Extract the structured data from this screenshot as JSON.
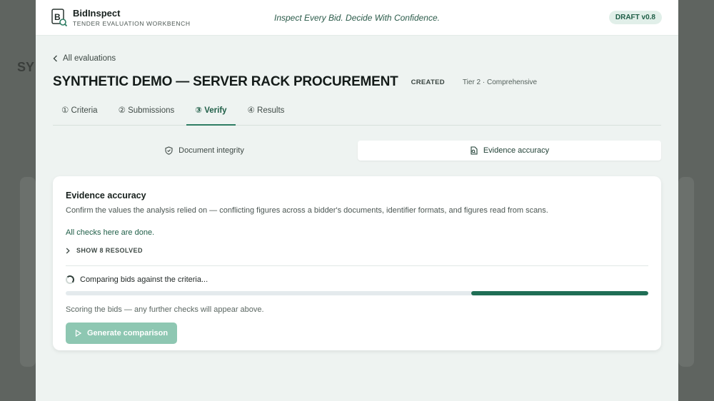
{
  "app": {
    "name": "BidInspect",
    "subtitle": "TENDER EVALUATION WORKBENCH",
    "tagline": "Inspect Every Bid. Decide With Confidence.",
    "version_badge": "DRAFT v0.8",
    "logo_letter": "B"
  },
  "nav": {
    "back_label": "All evaluations"
  },
  "evaluation": {
    "title": "SYNTHETIC DEMO — SERVER RACK PROCUREMENT",
    "status": "CREATED",
    "tier": "Tier 2 · Comprehensive"
  },
  "tabs": [
    {
      "label": "① Criteria",
      "active": false
    },
    {
      "label": "② Submissions",
      "active": false
    },
    {
      "label": "③ Verify",
      "active": true
    },
    {
      "label": "④ Results",
      "active": false
    }
  ],
  "subtabs": [
    {
      "label": "Document integrity",
      "icon": "shield-icon",
      "active": false
    },
    {
      "label": "Evidence accuracy",
      "icon": "document-search-icon",
      "active": true
    }
  ],
  "card": {
    "title": "Evidence accuracy",
    "description": "Confirm the values the analysis relied on — conflicting figures across a bidder's documents, identifier formats, and figures read from scans.",
    "done_message": "All checks here are done.",
    "resolved_toggle": "SHOW 8 RESOLVED",
    "progress_label": "Comparing bids against the criteria...",
    "progress": {
      "start_fraction": 0.696,
      "end_fraction": 1.0
    },
    "scoring_note": "Scoring the bids — any further checks will appear above.",
    "generate_button": "Generate comparison"
  },
  "colors": {
    "accent": "#1f6e55",
    "button_disabled": "#8ec7b2",
    "badge_bg": "#e1efe9"
  }
}
